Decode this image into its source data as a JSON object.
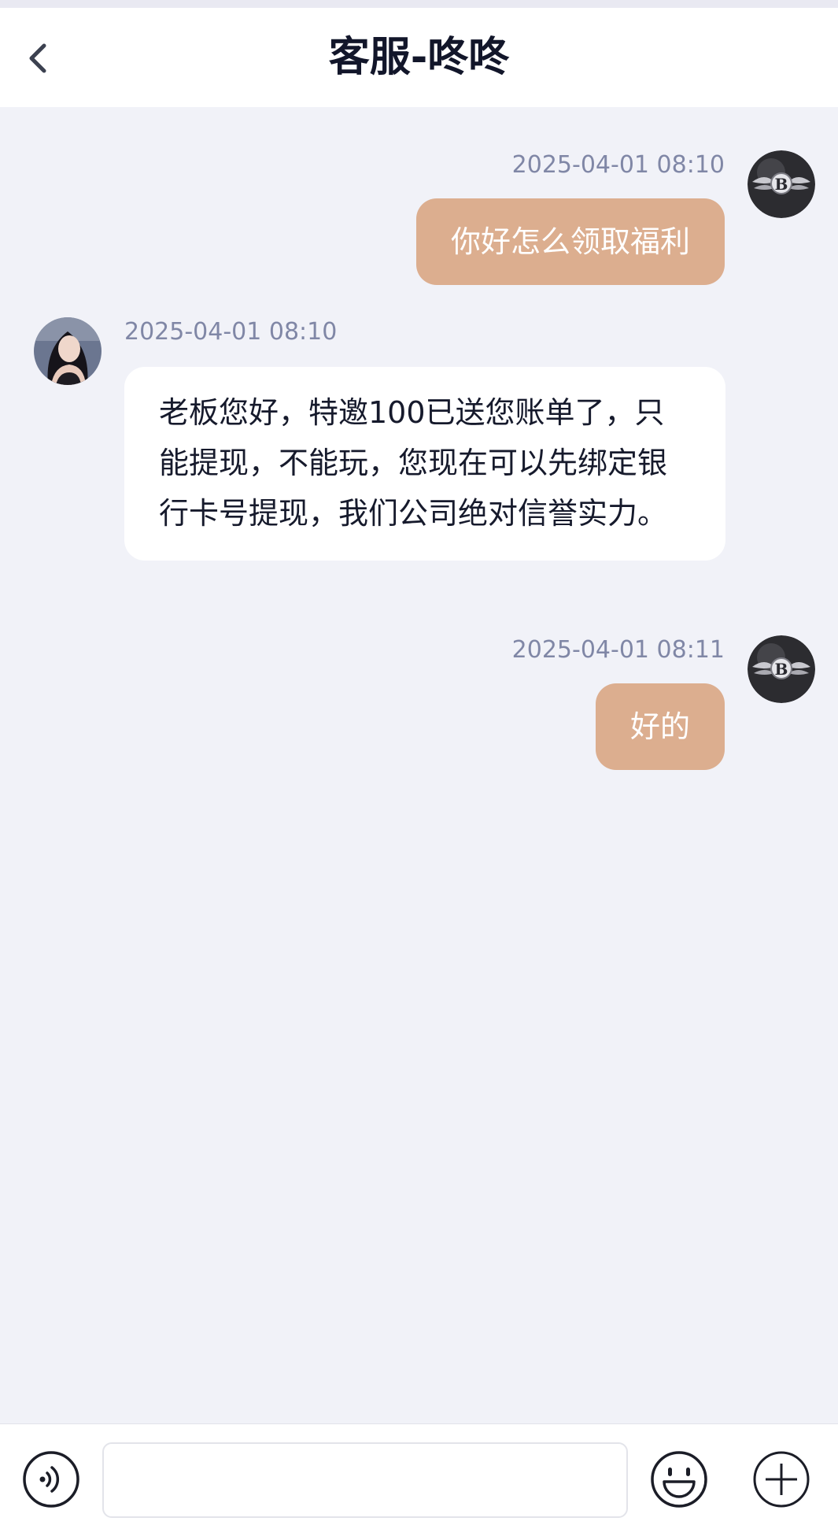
{
  "header": {
    "title": "客服-咚咚"
  },
  "messages": [
    {
      "side": "out",
      "time": "2025-04-01 08:10",
      "text": "你好怎么领取福利",
      "avatar": "user-avatar"
    },
    {
      "side": "in",
      "time": "2025-04-01 08:10",
      "text": "老板您好，特邀100已送您账单了，只能提现，不能玩，您现在可以先绑定银行卡号提现，我们公司绝对信誉实力。",
      "avatar": "agent-avatar"
    },
    {
      "side": "out",
      "time": "2025-04-01 08:11",
      "text": "好的",
      "avatar": "user-avatar"
    }
  ],
  "input": {
    "value": "",
    "placeholder": ""
  },
  "icons": {
    "back": "chevron-left-icon",
    "voice": "voice-icon",
    "emoji": "emoji-icon",
    "more": "plus-icon"
  },
  "colors": {
    "page_bg": "#f1f2f8",
    "outgoing_bubble": "#dcae8f",
    "incoming_bubble": "#ffffff",
    "timestamp": "#8087a6"
  }
}
